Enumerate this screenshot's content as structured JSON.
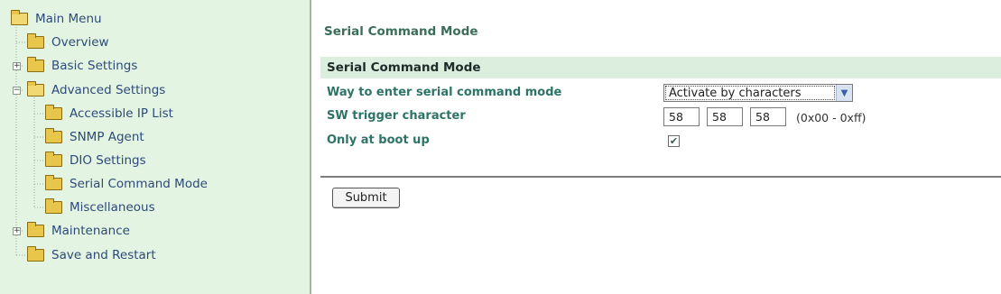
{
  "sidebar": {
    "main_menu": "Main Menu",
    "items": [
      {
        "label": "Overview",
        "has_expander": false,
        "expander": ""
      },
      {
        "label": "Basic Settings",
        "has_expander": true,
        "expander": "+"
      },
      {
        "label": "Advanced Settings",
        "has_expander": true,
        "expander": "−"
      },
      {
        "label": "Accessible IP List"
      },
      {
        "label": "SNMP Agent"
      },
      {
        "label": "DIO Settings"
      },
      {
        "label": "Serial Command Mode"
      },
      {
        "label": "Miscellaneous"
      },
      {
        "label": "Maintenance",
        "expander": "+"
      },
      {
        "label": "Save and Restart"
      }
    ]
  },
  "main": {
    "page_title": "Serial Command Mode",
    "section_header": "Serial Command Mode",
    "fields": {
      "way_label": "Way to enter serial command mode",
      "way_value": "Activate by characters",
      "trigger_label": "SW trigger character",
      "trigger_values": [
        "58",
        "58",
        "58"
      ],
      "trigger_range": "(0x00 - 0xff)",
      "boot_label": "Only at boot up",
      "boot_checked": true,
      "boot_check_glyph": "✔"
    },
    "submit_label": "Submit"
  },
  "colors": {
    "sidebar_bg": "#e4f4e2",
    "section_bg": "#dcefdf",
    "label_green": "#2e7466",
    "link_blue": "#2d4a7a"
  }
}
